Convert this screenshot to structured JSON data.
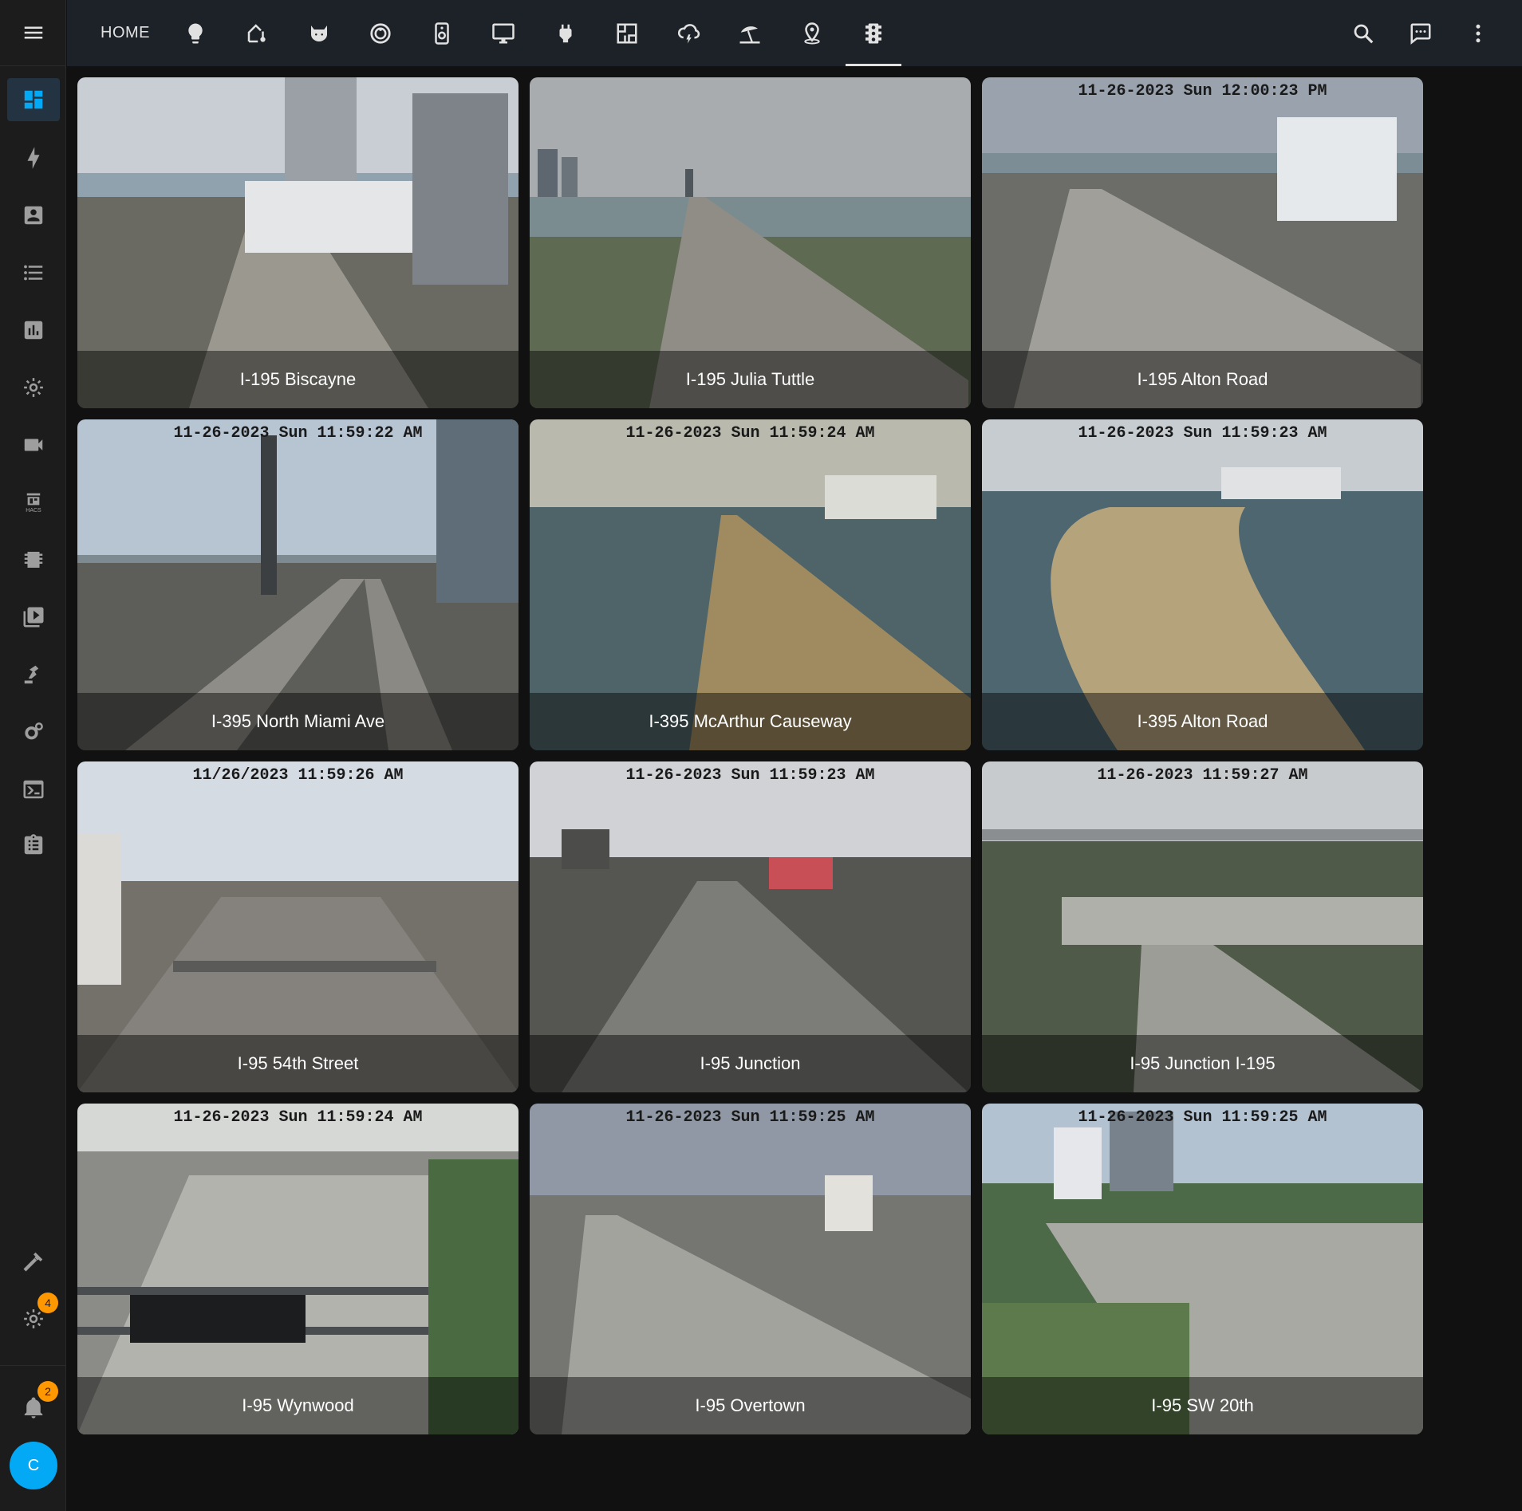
{
  "header": {
    "home_label": "HOME",
    "views": [
      {
        "icon": "lightbulb-icon"
      },
      {
        "icon": "home-thermometer-icon"
      },
      {
        "icon": "cat-icon"
      },
      {
        "icon": "robot-vacuum-icon"
      },
      {
        "icon": "speaker-icon"
      },
      {
        "icon": "monitor-icon"
      },
      {
        "icon": "power-plug-icon"
      },
      {
        "icon": "floor-plan-icon"
      },
      {
        "icon": "weather-lightning-rainy-icon"
      },
      {
        "icon": "beach-icon"
      },
      {
        "icon": "map-marker-radius-icon"
      },
      {
        "icon": "traffic-light-icon",
        "active": true
      }
    ],
    "actions": [
      {
        "icon": "search-icon"
      },
      {
        "icon": "assist-chat-icon"
      },
      {
        "icon": "dots-vertical-icon"
      }
    ]
  },
  "sidebar": {
    "items": [
      {
        "icon": "view-dashboard-icon",
        "active": true
      },
      {
        "icon": "lightning-bolt-icon"
      },
      {
        "icon": "account-box-icon"
      },
      {
        "icon": "format-list-bulleted-icon"
      },
      {
        "icon": "chart-box-icon"
      },
      {
        "icon": "cog-icon"
      },
      {
        "icon": "video-camera-icon"
      },
      {
        "icon": "hacs-store-icon",
        "sublabel": "HACS"
      },
      {
        "icon": "chip-icon"
      },
      {
        "icon": "play-box-multiple-icon"
      },
      {
        "icon": "robot-arm-icon"
      },
      {
        "icon": "cogs-icon"
      },
      {
        "icon": "console-icon"
      },
      {
        "icon": "clipboard-list-icon"
      }
    ],
    "developer_tools_icon": "hammer-icon",
    "settings_badge": "4",
    "notifications_badge": "2",
    "user_initial": "C"
  },
  "cameras": [
    {
      "name": "I-195 Biscayne",
      "osd": "",
      "sky": "#c9ced4",
      "ground": "#6b6a62",
      "water": "#8fa2ad"
    },
    {
      "name": "I-195 Julia Tuttle",
      "osd": "",
      "sky": "#a9acaf",
      "ground": "#5f6a52",
      "water": "#7a8c90"
    },
    {
      "name": "I-195 Alton Road",
      "osd": "11-26-2023 Sun 12:00:23 PM",
      "sky": "#9aa3ad",
      "ground": "#6c6d68",
      "water": "#7d8d95"
    },
    {
      "name": "I-395 North Miami Ave",
      "osd": "11-26-2023 Sun 11:59:22 AM",
      "sky": "#b7c4d2",
      "ground": "#5d5e5a",
      "water": "#7d8a92"
    },
    {
      "name": "I-395 McArthur Causeway",
      "osd": "11-26-2023 Sun 11:59:24 AM",
      "sky": "#b9b9ad",
      "ground": "#8c7a55",
      "water": "#4f6468"
    },
    {
      "name": "I-395 Alton Road",
      "osd": "11-26-2023 Sun 11:59:23 AM",
      "sky": "#c7ccd1",
      "ground": "#9b8764",
      "water": "#4d6670"
    },
    {
      "name": "I-95 54th Street",
      "osd": "11/26/2023 11:59:26 AM",
      "sky": "#d5dbe2",
      "ground": "#74706a",
      "water": "#8c8c88"
    },
    {
      "name": "I-95 Junction",
      "osd": "11-26-2023 Sun 11:59:23 AM",
      "sky": "#d0d2d5",
      "ground": "#555652",
      "water": "#6e7070"
    },
    {
      "name": "I-95 Junction I-195",
      "osd": "11-26-2023 11:59:27 AM",
      "sky": "#c8cbcd",
      "ground": "#4f5a48",
      "water": "#737573"
    },
    {
      "name": "I-95 Wynwood",
      "osd": "11-26-2023 Sun 11:59:24 AM",
      "sky": "#d6d8d6",
      "ground": "#8b8c88",
      "water": "#7b7d7a"
    },
    {
      "name": "I-95 Overtown",
      "osd": "11-26-2023 Sun 11:59:25 AM",
      "sky": "#8f98a4",
      "ground": "#757671",
      "water": "#6f7574"
    },
    {
      "name": "I-95 SW 20th",
      "osd": "11-26-2023 Sun 11:59:25 AM",
      "sky": "#b3c2d0",
      "ground": "#8b8a85",
      "water": "#4d6a48"
    }
  ]
}
